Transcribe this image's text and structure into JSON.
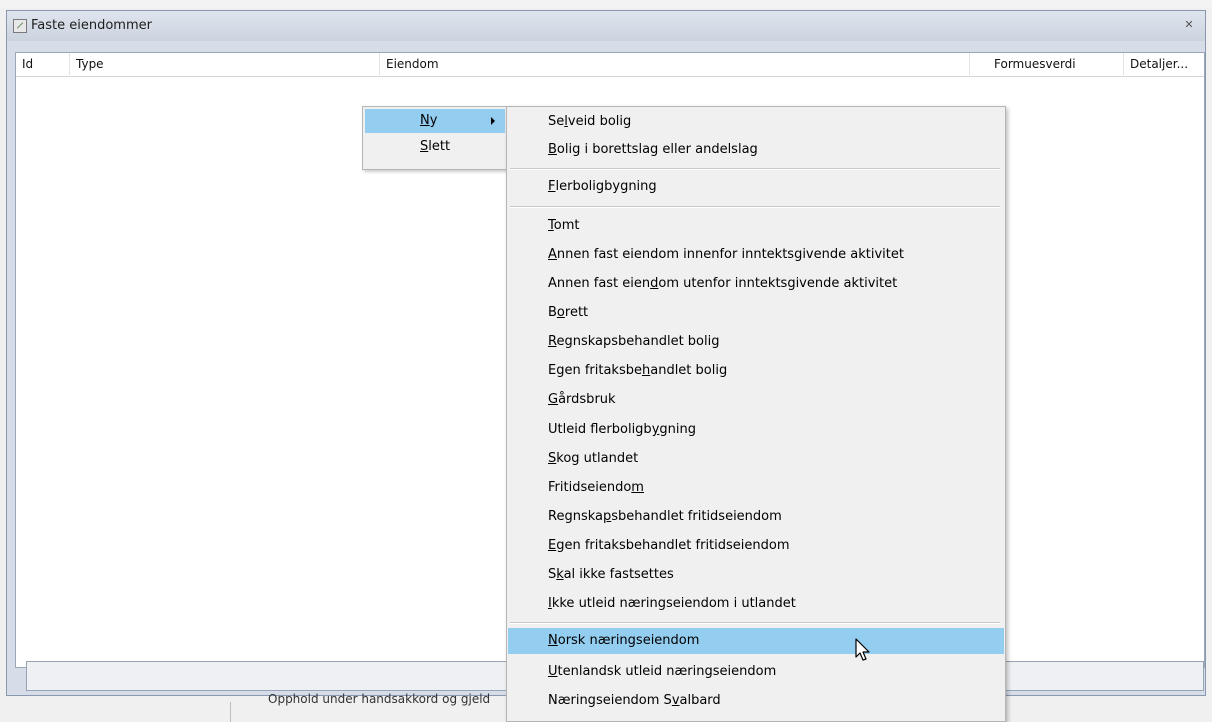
{
  "window": {
    "title": "Faste eiendommer",
    "close_glyph": "✕"
  },
  "list": {
    "columns": [
      "Id",
      "Type",
      "Eiendom",
      "Formuesverdi",
      "Detaljer..."
    ]
  },
  "background": {
    "partial_text": "Opphold under handsakkord og gjeld"
  },
  "menu": {
    "items": [
      {
        "pre": "",
        "key": "N",
        "post": "y"
      },
      {
        "pre": "",
        "key": "S",
        "post": "lett"
      }
    ]
  },
  "submenu": {
    "items": [
      {
        "pre": "Se",
        "key": "l",
        "post": "veid bolig"
      },
      {
        "pre": "",
        "key": "B",
        "post": "olig i borettslag eller andelslag"
      },
      {
        "pre": "",
        "key": "F",
        "post": "lerboligbygning"
      },
      {
        "pre": "",
        "key": "T",
        "post": "omt"
      },
      {
        "pre": "",
        "key": "A",
        "post": "nnen fast eiendom innenfor inntektsgivende aktivitet"
      },
      {
        "pre": "Annen fast eien",
        "key": "d",
        "post": "om utenfor inntektsgivende aktivitet"
      },
      {
        "pre": "B",
        "key": "o",
        "post": "rett"
      },
      {
        "pre": "",
        "key": "R",
        "post": "egnskapsbehandlet bolig"
      },
      {
        "pre": "Egen fritaksbe",
        "key": "h",
        "post": "andlet bolig"
      },
      {
        "pre": "",
        "key": "G",
        "post": "årdsbruk"
      },
      {
        "pre": "Utleid flerboligb",
        "key": "y",
        "post": "gning"
      },
      {
        "pre": "",
        "key": "S",
        "post": "kog utlandet"
      },
      {
        "pre": "Fritidseiendo",
        "key": "m",
        "post": ""
      },
      {
        "pre": "Regnska",
        "key": "p",
        "post": "sbehandlet fritidseiendom"
      },
      {
        "pre": "",
        "key": "E",
        "post": "gen fritaksbehandlet fritidseiendom"
      },
      {
        "pre": "S",
        "key": "k",
        "post": "al ikke fastsettes"
      },
      {
        "pre": "",
        "key": "I",
        "post": "kke utleid næringseiendom i utlandet"
      },
      {
        "pre": "",
        "key": "N",
        "post": "orsk næringseiendom"
      },
      {
        "pre": "",
        "key": "U",
        "post": "tenlandsk utleid næringseiendom"
      },
      {
        "pre": "Næringseiendom S",
        "key": "v",
        "post": "albard"
      }
    ]
  },
  "colors": {
    "highlight": "#93cdf0",
    "menu_bg": "#f0f0f0"
  },
  "icons": {
    "window_icon": "pen-square-icon",
    "arrow": "submenu-arrow-icon",
    "cursor": "mouse-pointer-icon"
  }
}
